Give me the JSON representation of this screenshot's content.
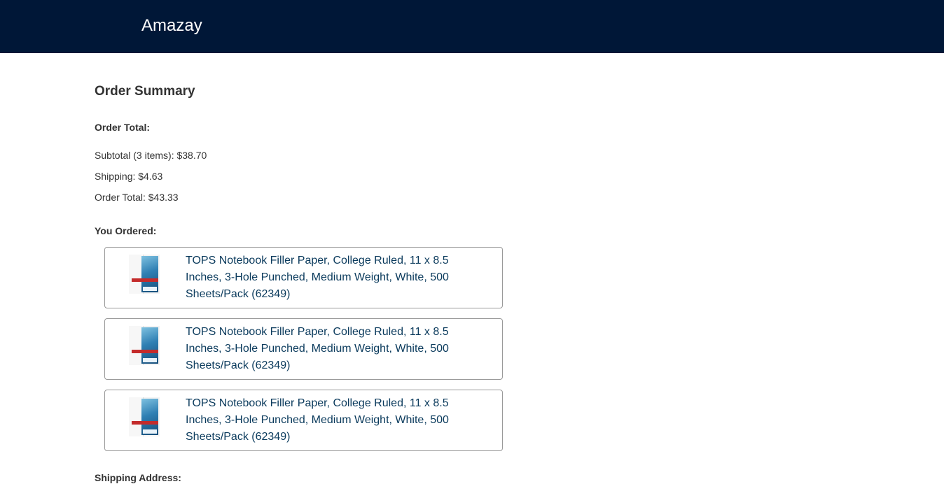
{
  "header": {
    "brand": "Amazay",
    "background_color": "#001737"
  },
  "summary": {
    "title": "Order Summary",
    "order_total_label": "Order Total:",
    "subtotal_text": "Subtotal (3 items): $38.70",
    "shipping_text": "Shipping: $4.63",
    "order_total_text": "Order Total: $43.33"
  },
  "ordered": {
    "label": "You Ordered:",
    "items": [
      {
        "title": "TOPS Notebook Filler Paper, College Ruled, 11 x 8.5 Inches, 3-Hole Punched, Medium Weight, White, 500 Sheets/Pack (62349)",
        "image_icon": "notebook-paper-product-image"
      },
      {
        "title": "TOPS Notebook Filler Paper, College Ruled, 11 x 8.5 Inches, 3-Hole Punched, Medium Weight, White, 500 Sheets/Pack (62349)",
        "image_icon": "notebook-paper-product-image"
      },
      {
        "title": "TOPS Notebook Filler Paper, College Ruled, 11 x 8.5 Inches, 3-Hole Punched, Medium Weight, White, 500 Sheets/Pack (62349)",
        "image_icon": "notebook-paper-product-image"
      }
    ]
  },
  "shipping": {
    "label": "Shipping Address:"
  }
}
